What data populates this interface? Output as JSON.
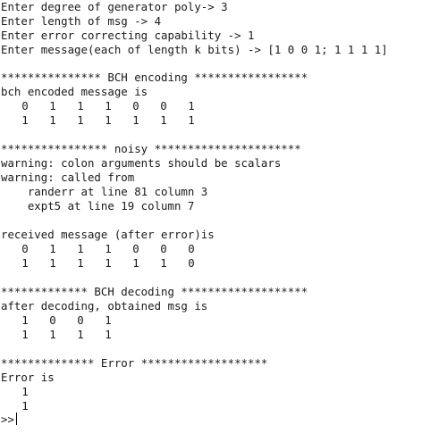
{
  "inputs": {
    "degree_prompt": "Enter degree of generator poly-> 3",
    "length_prompt": "Enter length of msg -> 4",
    "capability_prompt": "Enter error correcting capability -> 1",
    "message_prompt": "Enter message(each of length k bits) -> [1 0 0 1; 1 1 1 1]"
  },
  "encoding": {
    "banner": "*************** BCH encoding *****************",
    "label": "bch encoded message is",
    "matrix": [
      [
        "0",
        "1",
        "1",
        "1",
        "0",
        "0",
        "1"
      ],
      [
        "1",
        "1",
        "1",
        "1",
        "1",
        "1",
        "1"
      ]
    ]
  },
  "noisy": {
    "banner": "**************** noisy **********************",
    "warning1": "warning: colon arguments should be scalars",
    "warning2": "warning: called from",
    "trace1": "    randerr at line 81 column 3",
    "trace2": "    expt5 at line 19 column 7"
  },
  "received": {
    "label": "received message (after error)is",
    "matrix": [
      [
        "0",
        "1",
        "1",
        "1",
        "0",
        "0",
        "0"
      ],
      [
        "1",
        "1",
        "1",
        "1",
        "1",
        "1",
        "0"
      ]
    ]
  },
  "decoding": {
    "banner": "************* BCH decoding *******************",
    "label": "after decoding, obtained msg is",
    "matrix": [
      [
        "1",
        "0",
        "0",
        "1"
      ],
      [
        "1",
        "1",
        "1",
        "1"
      ]
    ]
  },
  "error": {
    "banner": "************** Error *******************",
    "label": "Error is",
    "values": [
      "1",
      "1"
    ]
  },
  "prompt": ">>"
}
